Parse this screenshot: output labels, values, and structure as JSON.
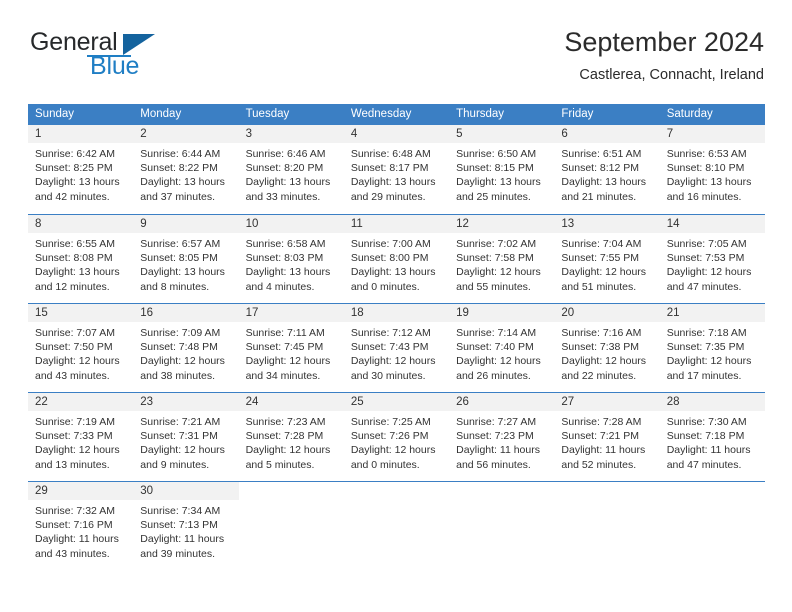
{
  "brand": {
    "name_part1": "General",
    "name_part2": "Blue",
    "logo_icon": "triangle-logo-icon"
  },
  "header": {
    "title": "September 2024",
    "location": "Castlerea, Connacht, Ireland"
  },
  "calendar": {
    "weekday_headers": [
      "Sunday",
      "Monday",
      "Tuesday",
      "Wednesday",
      "Thursday",
      "Friday",
      "Saturday"
    ],
    "colors": {
      "header_blue": "#3b7fc4",
      "daynum_strip": "#f2f2f2",
      "brand_blue": "#1f7ec4",
      "text": "#333333"
    },
    "weeks": [
      [
        {
          "day": "1",
          "sunrise": "Sunrise: 6:42 AM",
          "sunset": "Sunset: 8:25 PM",
          "daylight_line1": "Daylight: 13 hours",
          "daylight_line2": "and 42 minutes."
        },
        {
          "day": "2",
          "sunrise": "Sunrise: 6:44 AM",
          "sunset": "Sunset: 8:22 PM",
          "daylight_line1": "Daylight: 13 hours",
          "daylight_line2": "and 37 minutes."
        },
        {
          "day": "3",
          "sunrise": "Sunrise: 6:46 AM",
          "sunset": "Sunset: 8:20 PM",
          "daylight_line1": "Daylight: 13 hours",
          "daylight_line2": "and 33 minutes."
        },
        {
          "day": "4",
          "sunrise": "Sunrise: 6:48 AM",
          "sunset": "Sunset: 8:17 PM",
          "daylight_line1": "Daylight: 13 hours",
          "daylight_line2": "and 29 minutes."
        },
        {
          "day": "5",
          "sunrise": "Sunrise: 6:50 AM",
          "sunset": "Sunset: 8:15 PM",
          "daylight_line1": "Daylight: 13 hours",
          "daylight_line2": "and 25 minutes."
        },
        {
          "day": "6",
          "sunrise": "Sunrise: 6:51 AM",
          "sunset": "Sunset: 8:12 PM",
          "daylight_line1": "Daylight: 13 hours",
          "daylight_line2": "and 21 minutes."
        },
        {
          "day": "7",
          "sunrise": "Sunrise: 6:53 AM",
          "sunset": "Sunset: 8:10 PM",
          "daylight_line1": "Daylight: 13 hours",
          "daylight_line2": "and 16 minutes."
        }
      ],
      [
        {
          "day": "8",
          "sunrise": "Sunrise: 6:55 AM",
          "sunset": "Sunset: 8:08 PM",
          "daylight_line1": "Daylight: 13 hours",
          "daylight_line2": "and 12 minutes."
        },
        {
          "day": "9",
          "sunrise": "Sunrise: 6:57 AM",
          "sunset": "Sunset: 8:05 PM",
          "daylight_line1": "Daylight: 13 hours",
          "daylight_line2": "and 8 minutes."
        },
        {
          "day": "10",
          "sunrise": "Sunrise: 6:58 AM",
          "sunset": "Sunset: 8:03 PM",
          "daylight_line1": "Daylight: 13 hours",
          "daylight_line2": "and 4 minutes."
        },
        {
          "day": "11",
          "sunrise": "Sunrise: 7:00 AM",
          "sunset": "Sunset: 8:00 PM",
          "daylight_line1": "Daylight: 13 hours",
          "daylight_line2": "and 0 minutes."
        },
        {
          "day": "12",
          "sunrise": "Sunrise: 7:02 AM",
          "sunset": "Sunset: 7:58 PM",
          "daylight_line1": "Daylight: 12 hours",
          "daylight_line2": "and 55 minutes."
        },
        {
          "day": "13",
          "sunrise": "Sunrise: 7:04 AM",
          "sunset": "Sunset: 7:55 PM",
          "daylight_line1": "Daylight: 12 hours",
          "daylight_line2": "and 51 minutes."
        },
        {
          "day": "14",
          "sunrise": "Sunrise: 7:05 AM",
          "sunset": "Sunset: 7:53 PM",
          "daylight_line1": "Daylight: 12 hours",
          "daylight_line2": "and 47 minutes."
        }
      ],
      [
        {
          "day": "15",
          "sunrise": "Sunrise: 7:07 AM",
          "sunset": "Sunset: 7:50 PM",
          "daylight_line1": "Daylight: 12 hours",
          "daylight_line2": "and 43 minutes."
        },
        {
          "day": "16",
          "sunrise": "Sunrise: 7:09 AM",
          "sunset": "Sunset: 7:48 PM",
          "daylight_line1": "Daylight: 12 hours",
          "daylight_line2": "and 38 minutes."
        },
        {
          "day": "17",
          "sunrise": "Sunrise: 7:11 AM",
          "sunset": "Sunset: 7:45 PM",
          "daylight_line1": "Daylight: 12 hours",
          "daylight_line2": "and 34 minutes."
        },
        {
          "day": "18",
          "sunrise": "Sunrise: 7:12 AM",
          "sunset": "Sunset: 7:43 PM",
          "daylight_line1": "Daylight: 12 hours",
          "daylight_line2": "and 30 minutes."
        },
        {
          "day": "19",
          "sunrise": "Sunrise: 7:14 AM",
          "sunset": "Sunset: 7:40 PM",
          "daylight_line1": "Daylight: 12 hours",
          "daylight_line2": "and 26 minutes."
        },
        {
          "day": "20",
          "sunrise": "Sunrise: 7:16 AM",
          "sunset": "Sunset: 7:38 PM",
          "daylight_line1": "Daylight: 12 hours",
          "daylight_line2": "and 22 minutes."
        },
        {
          "day": "21",
          "sunrise": "Sunrise: 7:18 AM",
          "sunset": "Sunset: 7:35 PM",
          "daylight_line1": "Daylight: 12 hours",
          "daylight_line2": "and 17 minutes."
        }
      ],
      [
        {
          "day": "22",
          "sunrise": "Sunrise: 7:19 AM",
          "sunset": "Sunset: 7:33 PM",
          "daylight_line1": "Daylight: 12 hours",
          "daylight_line2": "and 13 minutes."
        },
        {
          "day": "23",
          "sunrise": "Sunrise: 7:21 AM",
          "sunset": "Sunset: 7:31 PM",
          "daylight_line1": "Daylight: 12 hours",
          "daylight_line2": "and 9 minutes."
        },
        {
          "day": "24",
          "sunrise": "Sunrise: 7:23 AM",
          "sunset": "Sunset: 7:28 PM",
          "daylight_line1": "Daylight: 12 hours",
          "daylight_line2": "and 5 minutes."
        },
        {
          "day": "25",
          "sunrise": "Sunrise: 7:25 AM",
          "sunset": "Sunset: 7:26 PM",
          "daylight_line1": "Daylight: 12 hours",
          "daylight_line2": "and 0 minutes."
        },
        {
          "day": "26",
          "sunrise": "Sunrise: 7:27 AM",
          "sunset": "Sunset: 7:23 PM",
          "daylight_line1": "Daylight: 11 hours",
          "daylight_line2": "and 56 minutes."
        },
        {
          "day": "27",
          "sunrise": "Sunrise: 7:28 AM",
          "sunset": "Sunset: 7:21 PM",
          "daylight_line1": "Daylight: 11 hours",
          "daylight_line2": "and 52 minutes."
        },
        {
          "day": "28",
          "sunrise": "Sunrise: 7:30 AM",
          "sunset": "Sunset: 7:18 PM",
          "daylight_line1": "Daylight: 11 hours",
          "daylight_line2": "and 47 minutes."
        }
      ],
      [
        {
          "day": "29",
          "sunrise": "Sunrise: 7:32 AM",
          "sunset": "Sunset: 7:16 PM",
          "daylight_line1": "Daylight: 11 hours",
          "daylight_line2": "and 43 minutes."
        },
        {
          "day": "30",
          "sunrise": "Sunrise: 7:34 AM",
          "sunset": "Sunset: 7:13 PM",
          "daylight_line1": "Daylight: 11 hours",
          "daylight_line2": "and 39 minutes."
        },
        null,
        null,
        null,
        null,
        null
      ]
    ]
  }
}
